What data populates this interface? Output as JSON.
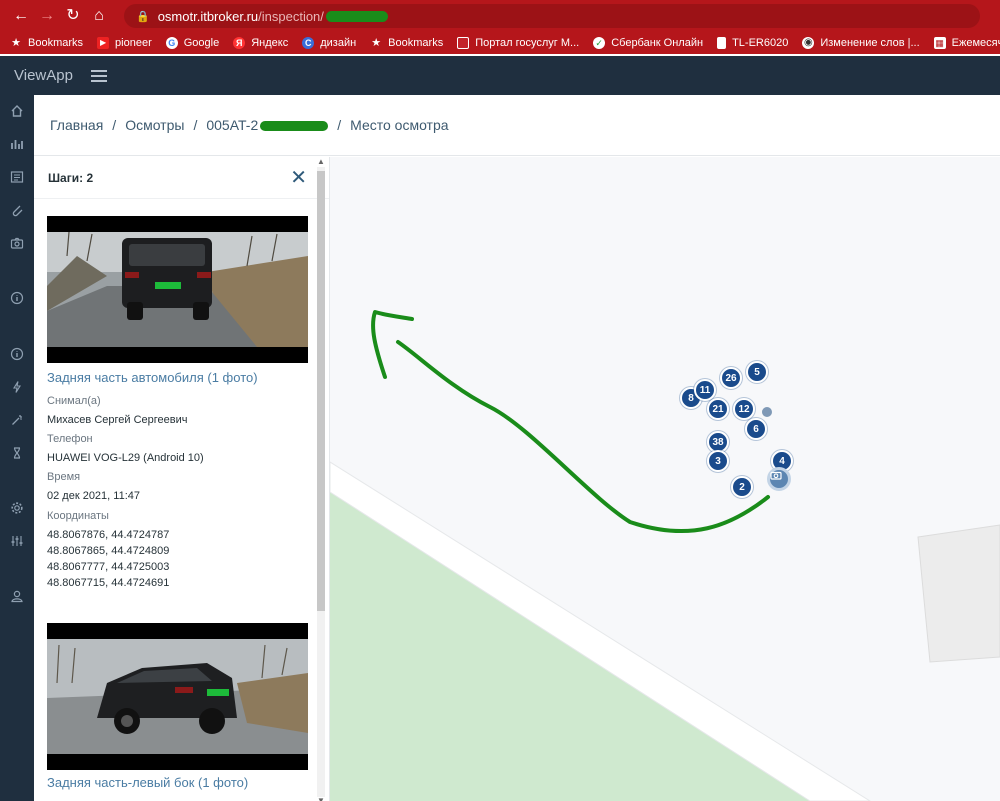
{
  "browser": {
    "url_host": "osmotr.itbroker.ru",
    "url_path": "/inspection/",
    "bookmarks": [
      {
        "label": "Bookmarks",
        "icon": "star-icon"
      },
      {
        "label": "pioneer",
        "icon": "pioneer-icon"
      },
      {
        "label": "Google",
        "icon": "google-icon"
      },
      {
        "label": "Яндекс",
        "icon": "yandex-icon"
      },
      {
        "label": "дизайн",
        "icon": "design-icon"
      },
      {
        "label": "Bookmarks",
        "icon": "star-icon"
      },
      {
        "label": "Портал госуслуг М...",
        "icon": "gosuslugi-icon"
      },
      {
        "label": "Сбербанк Онлайн",
        "icon": "sberbank-icon"
      },
      {
        "label": "TL-ER6020",
        "icon": "document-icon"
      },
      {
        "label": "Изменение слов |...",
        "icon": "globe-icon"
      },
      {
        "label": "Ежемесячный вып...",
        "icon": "calendar-icon"
      }
    ]
  },
  "app": {
    "brand": "ViewApp"
  },
  "breadcrumb": {
    "home": "Главная",
    "inspections": "Осмотры",
    "code": "005AT-2",
    "current": "Место осмотра",
    "separator": "/"
  },
  "panel": {
    "title": "Шаги: 2",
    "steps": [
      {
        "title": "Задняя часть автомобиля (1 фото)",
        "shot_by_label": "Снимал(а)",
        "shot_by": "Михасев Сергей Сергеевич",
        "phone_label": "Телефон",
        "phone": "HUAWEI VOG-L29 (Android 10)",
        "time_label": "Время",
        "time": "02 дек 2021, 11:47",
        "coords_label": "Координаты",
        "coords": [
          "48.8067876, 44.4724787",
          "48.8067865, 44.4724809",
          "48.8067777, 44.4725003",
          "48.8067715, 44.4724691"
        ]
      },
      {
        "title": "Задняя часть-левый бок (1 фото)"
      }
    ]
  },
  "map": {
    "markers": [
      "5",
      "26",
      "11",
      "8",
      "21",
      "12",
      "6",
      "38",
      "3",
      "4",
      "2"
    ]
  },
  "colors": {
    "browser_bar": "#b5161b",
    "app_header": "#1f2f3f",
    "marker": "#1a4b8c",
    "link": "#4a7ca3",
    "annotation": "#1a8c1a"
  }
}
